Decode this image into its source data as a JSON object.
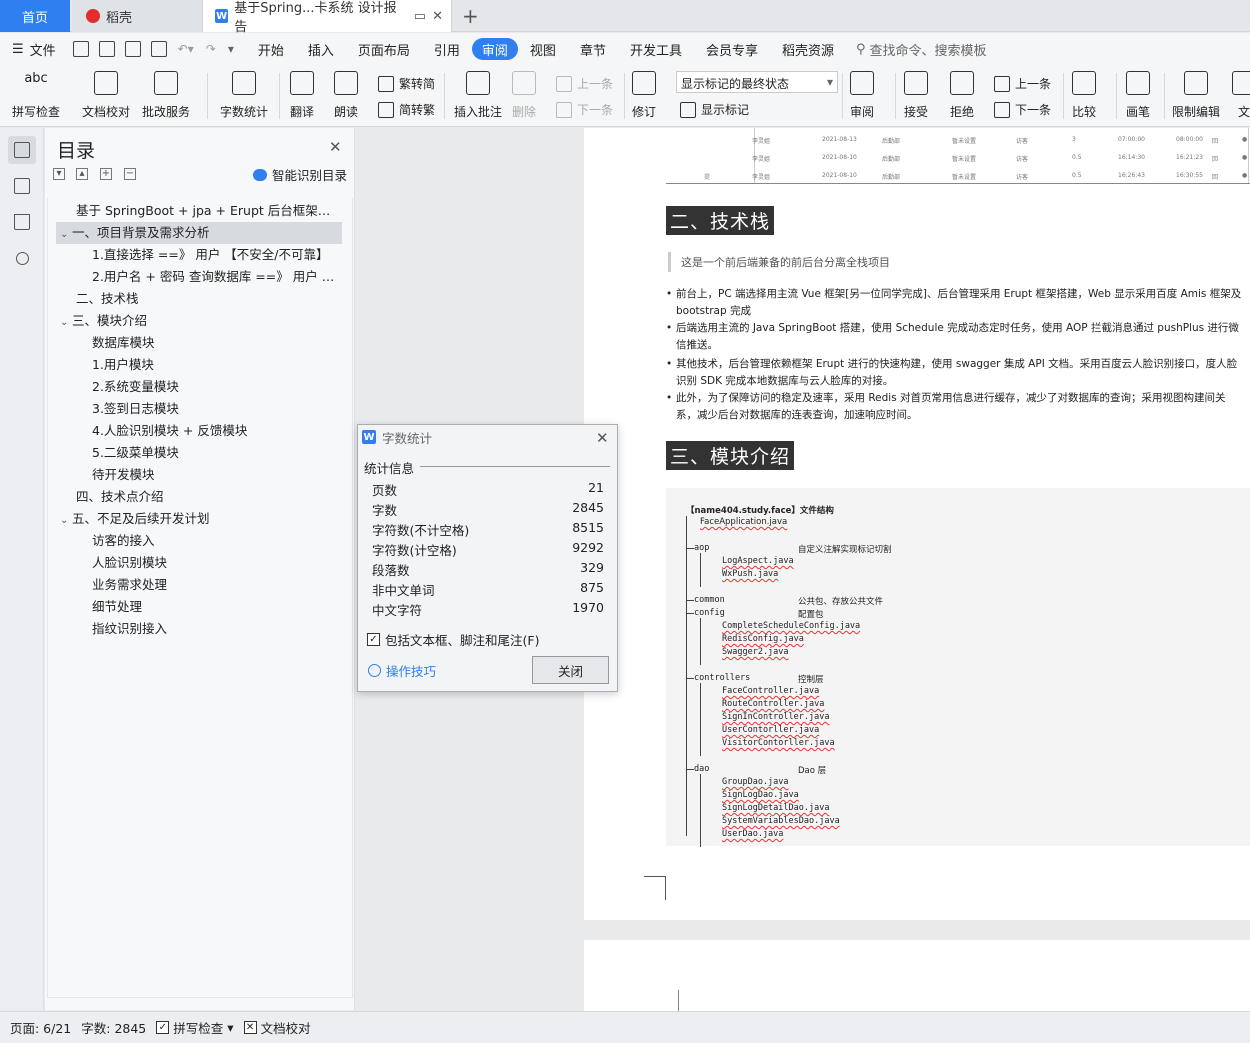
{
  "tabs": {
    "home": "首页",
    "daoke": "稻壳",
    "doc": "基于Spring...卡系统 设计报告"
  },
  "menu": {
    "file": "文件",
    "items": [
      "开始",
      "插入",
      "页面布局",
      "引用",
      "审阅",
      "视图",
      "章节",
      "开发工具",
      "会员专享",
      "稻壳资源"
    ],
    "active": "审阅",
    "search": "查找命令、搜索模板"
  },
  "ribbon": {
    "spell": "拼写检查",
    "proof": "文档校对",
    "annotate": "批改服务",
    "wordcount": "字数统计",
    "translate": "翻译",
    "read": "朗读",
    "to_trad": "繁转简",
    "to_simp": "简转繁",
    "insert_comment": "插入批注",
    "delete": "删除",
    "prev": "上一条",
    "next": "下一条",
    "revise": "修订",
    "mark_state": "显示标记的最终状态",
    "show_marks": "显示标记",
    "review": "审阅",
    "accept": "接受",
    "reject": "拒绝",
    "prev2": "上一条",
    "next2": "下一条",
    "compare": "比较",
    "pen": "画笔",
    "restrict": "限制编辑",
    "doc_more": "文"
  },
  "toc": {
    "title": "目录",
    "smart": "智能识别目录",
    "items": [
      {
        "text": "基于 SpringBoot + jpa + Erupt 后台框架开...",
        "level": 0,
        "arrow": ""
      },
      {
        "text": "一、项目背景及需求分析",
        "level": 0,
        "arrow": "v"
      },
      {
        "text": "1.直接选择 ==》 用户 【不安全/不可靠】",
        "level": 1,
        "arrow": ""
      },
      {
        "text": "2.用户名 + 密码 查询数据库 ==》 用户 【...",
        "level": 1,
        "arrow": ""
      },
      {
        "text": "二、技术栈",
        "level": 0,
        "arrow": ""
      },
      {
        "text": "三、模块介绍",
        "level": 0,
        "arrow": "v"
      },
      {
        "text": "数据库模块",
        "level": 1,
        "arrow": ""
      },
      {
        "text": "1.用户模块",
        "level": 1,
        "arrow": ""
      },
      {
        "text": "2.系统变量模块",
        "level": 1,
        "arrow": ""
      },
      {
        "text": "3.签到日志模块",
        "level": 1,
        "arrow": ""
      },
      {
        "text": "4.人脸识别模块 + 反馈模块",
        "level": 1,
        "arrow": ""
      },
      {
        "text": "5.二级菜单模块",
        "level": 1,
        "arrow": ""
      },
      {
        "text": "待开发模块",
        "level": 1,
        "arrow": ""
      },
      {
        "text": "四、技术点介绍",
        "level": 0,
        "arrow": ""
      },
      {
        "text": "五、不足及后续开发计划",
        "level": 0,
        "arrow": "v"
      },
      {
        "text": "访客的接入",
        "level": 1,
        "arrow": ""
      },
      {
        "text": "人脸识别模块",
        "level": 1,
        "arrow": ""
      },
      {
        "text": "业务需求处理",
        "level": 1,
        "arrow": ""
      },
      {
        "text": "细节处理",
        "level": 1,
        "arrow": ""
      },
      {
        "text": "指纹识别接入",
        "level": 1,
        "arrow": ""
      }
    ],
    "selected_index": 1
  },
  "doc": {
    "table_rows": [
      [
        "李灵姐",
        "2021-08-13",
        "后勤部",
        "暂未设置",
        "访客",
        "3",
        "07:00:00",
        "08:00:00",
        "回",
        "●"
      ],
      [
        "李灵姐",
        "2021-08-10",
        "后勤部",
        "暂未设置",
        "访客",
        "0.5",
        "16:14:30",
        "16:21:23",
        "回",
        "●"
      ],
      [
        "李灵姐",
        "2021-08-10",
        "后勤部",
        "暂未设置",
        "访客",
        "0.5",
        "16:26:43",
        "16:30:55",
        "回",
        "●"
      ]
    ],
    "table_side": "提",
    "h_tech": "二、技术栈",
    "quote": "这是一个前后端兼备的前后台分离全栈项目",
    "bullets": [
      "前台上，PC 端选择用主流 Vue 框架[另一位同学完成]、后台管理采用 Erupt 框架搭建，Web 显示采用百度 Amis 框架及 bootstrap 完成",
      "后端选用主流的 Java SpringBoot 搭建，使用 Schedule 完成动态定时任务，使用 AOP 拦截消息通过 pushPlus 进行微信推送。",
      "其他技术，后台管理依赖框架 Erupt 进行的快速构建，使用 swagger 集成 API 文档。采用百度云人脸识别接口，度人脸识别 SDK 完成本地数据库与云人脸库的对接。",
      "此外，为了保障访问的稳定及速率，采用 Redis 对首页常用信息进行缓存，减少了对数据库的查询；采用视图构建间关系，减少后台对数据库的连表查询，加速响应时间。"
    ],
    "h_module": "三、模块介绍",
    "code_title": "【name404.study.face】文件结构",
    "code_root": "FaceApplication.java",
    "code_groups": [
      {
        "name": "aop",
        "comment": "自定义注解实现标记切割",
        "files": [
          "LogAspect.java",
          "WxPush.java"
        ]
      },
      {
        "name": "common",
        "comment": "公共包、存放公共文件",
        "files": []
      },
      {
        "name": "config",
        "comment": "配置包",
        "files": [
          "CompleteScheduleConfig.java",
          "RedisConfig.java",
          "Swagger2.java"
        ]
      },
      {
        "name": "controllers",
        "comment": "控制层",
        "files": [
          "FaceController.java",
          "RouteController.java",
          "SignInController.java",
          "UserContorller.java",
          "VisitorContorller.java"
        ]
      },
      {
        "name": "dao",
        "comment": "Dao 层",
        "files": [
          "GroupDao.java",
          "SignLogDao.java",
          "SignLogDetailDao.java",
          "SystemVariablesDao.java",
          "UserDao.java"
        ]
      }
    ]
  },
  "dialog": {
    "title": "字数统计",
    "section": "统计信息",
    "rows": [
      {
        "label": "页数",
        "value": "21"
      },
      {
        "label": "字数",
        "value": "2845"
      },
      {
        "label": "字符数(不计空格)",
        "value": "8515"
      },
      {
        "label": "字符数(计空格)",
        "value": "9292"
      },
      {
        "label": "段落数",
        "value": "329"
      },
      {
        "label": "非中文单词",
        "value": "875"
      },
      {
        "label": "中文字符",
        "value": "1970"
      }
    ],
    "include": "包括文本框、脚注和尾注(F)",
    "include_checked": true,
    "tips": "操作技巧",
    "close": "关闭"
  },
  "status": {
    "page": "页面: 6/21",
    "words": "字数: 2845",
    "spell": "拼写检查",
    "proof": "文档校对"
  },
  "colors": {
    "accent": "#2f7ff0",
    "heading_bg": "#333333"
  }
}
